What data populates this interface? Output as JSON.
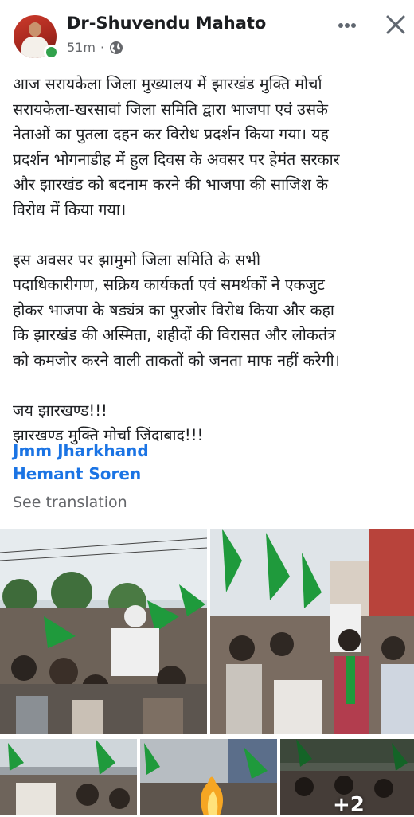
{
  "post": {
    "author": "Dr-Shuvendu Mahato",
    "time": "51m",
    "separator": "·",
    "paragraph1": "आज सरायकेला जिला मुख्यालय में झारखंड मुक्ति मोर्चा\nसरायकेला-खरसावां जिला समिति द्वारा भाजपा एवं उसके\nनेताओं का पुतला दहन कर विरोध प्रदर्शन किया गया। यह\nप्रदर्शन भोगनाडीह में हुल दिवस के अवसर पर हेमंत सरकार\nऔर झारखंड को बदनाम करने की भाजपा की साजिश के\nविरोध में किया गया।",
    "paragraph2": "इस अवसर पर झामुमो जिला समिति के सभी\nपदाधिकारीगण, सक्रिय कार्यकर्ता एवं समर्थकों ने एकजुट\nहोकर भाजपा के षड्यंत्र का पुरजोर विरोध किया और कहा\nकि झारखंड की अस्मिता, शहीदों की विरासत और लोकतंत्र\nको कमजोर करने वाली ताकतों को जनता माफ नहीं करेगी।",
    "paragraph3": "जय झारखण्ड!!!\nझारखण्ड मुक्ति मोर्चा जिंदाबाद!!!",
    "tag1": "Jmm Jharkhand",
    "tag2": "Hemant Soren",
    "see_translation": "See translation",
    "more_photos": "+2"
  },
  "icons": {
    "more": "more-horizontal-icon",
    "close": "close-icon",
    "audience": "globe-icon"
  },
  "colors": {
    "link": "#1b74e4",
    "meta": "#65676b",
    "online": "#31a24c",
    "flag_green": "#1f9a3c"
  }
}
